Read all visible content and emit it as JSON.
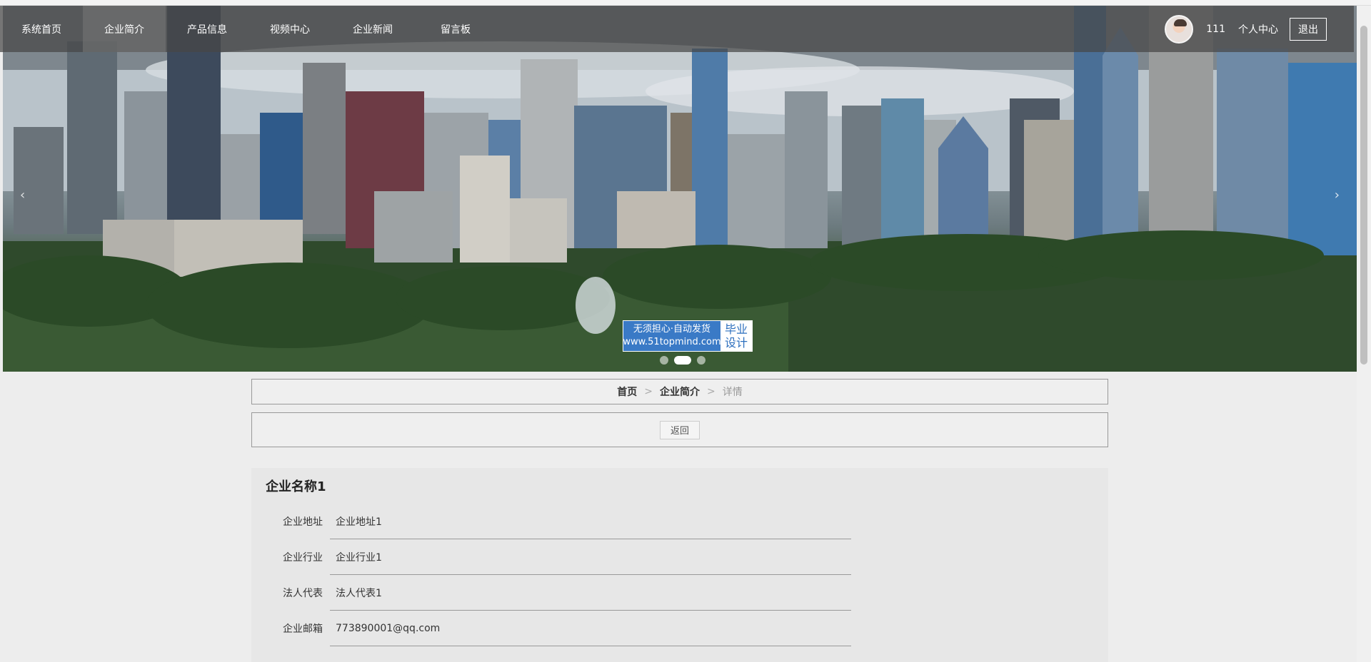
{
  "nav": {
    "items": [
      {
        "label": "系统首页"
      },
      {
        "label": "企业简介"
      },
      {
        "label": "产品信息"
      },
      {
        "label": "视频中心"
      },
      {
        "label": "企业新闻"
      },
      {
        "label": "留言板"
      }
    ],
    "user_name": "111",
    "profile_label": "个人中心",
    "logout_label": "退出"
  },
  "banner": {
    "prev_arrow": "‹",
    "next_arrow": "›",
    "watermark": {
      "line1": "无须担心·自动发货",
      "url": "www.51topmind.com",
      "right_line1": "毕业",
      "right_line2": "设计"
    }
  },
  "breadcrumb": {
    "home": "首页",
    "section": "企业简介",
    "current": "详情",
    "separator": ">"
  },
  "back_label": "返回",
  "detail": {
    "title": "企业名称1",
    "fields": [
      {
        "label": "企业地址",
        "value": "企业地址1"
      },
      {
        "label": "企业行业",
        "value": "企业行业1"
      },
      {
        "label": "法人代表",
        "value": "法人代表1"
      },
      {
        "label": "企业邮箱",
        "value": "773890001@qq.com"
      }
    ]
  },
  "colors": {
    "nav_bg": "#464646",
    "page_bg": "#ededed",
    "watermark_blue": "#3a7ac6"
  }
}
